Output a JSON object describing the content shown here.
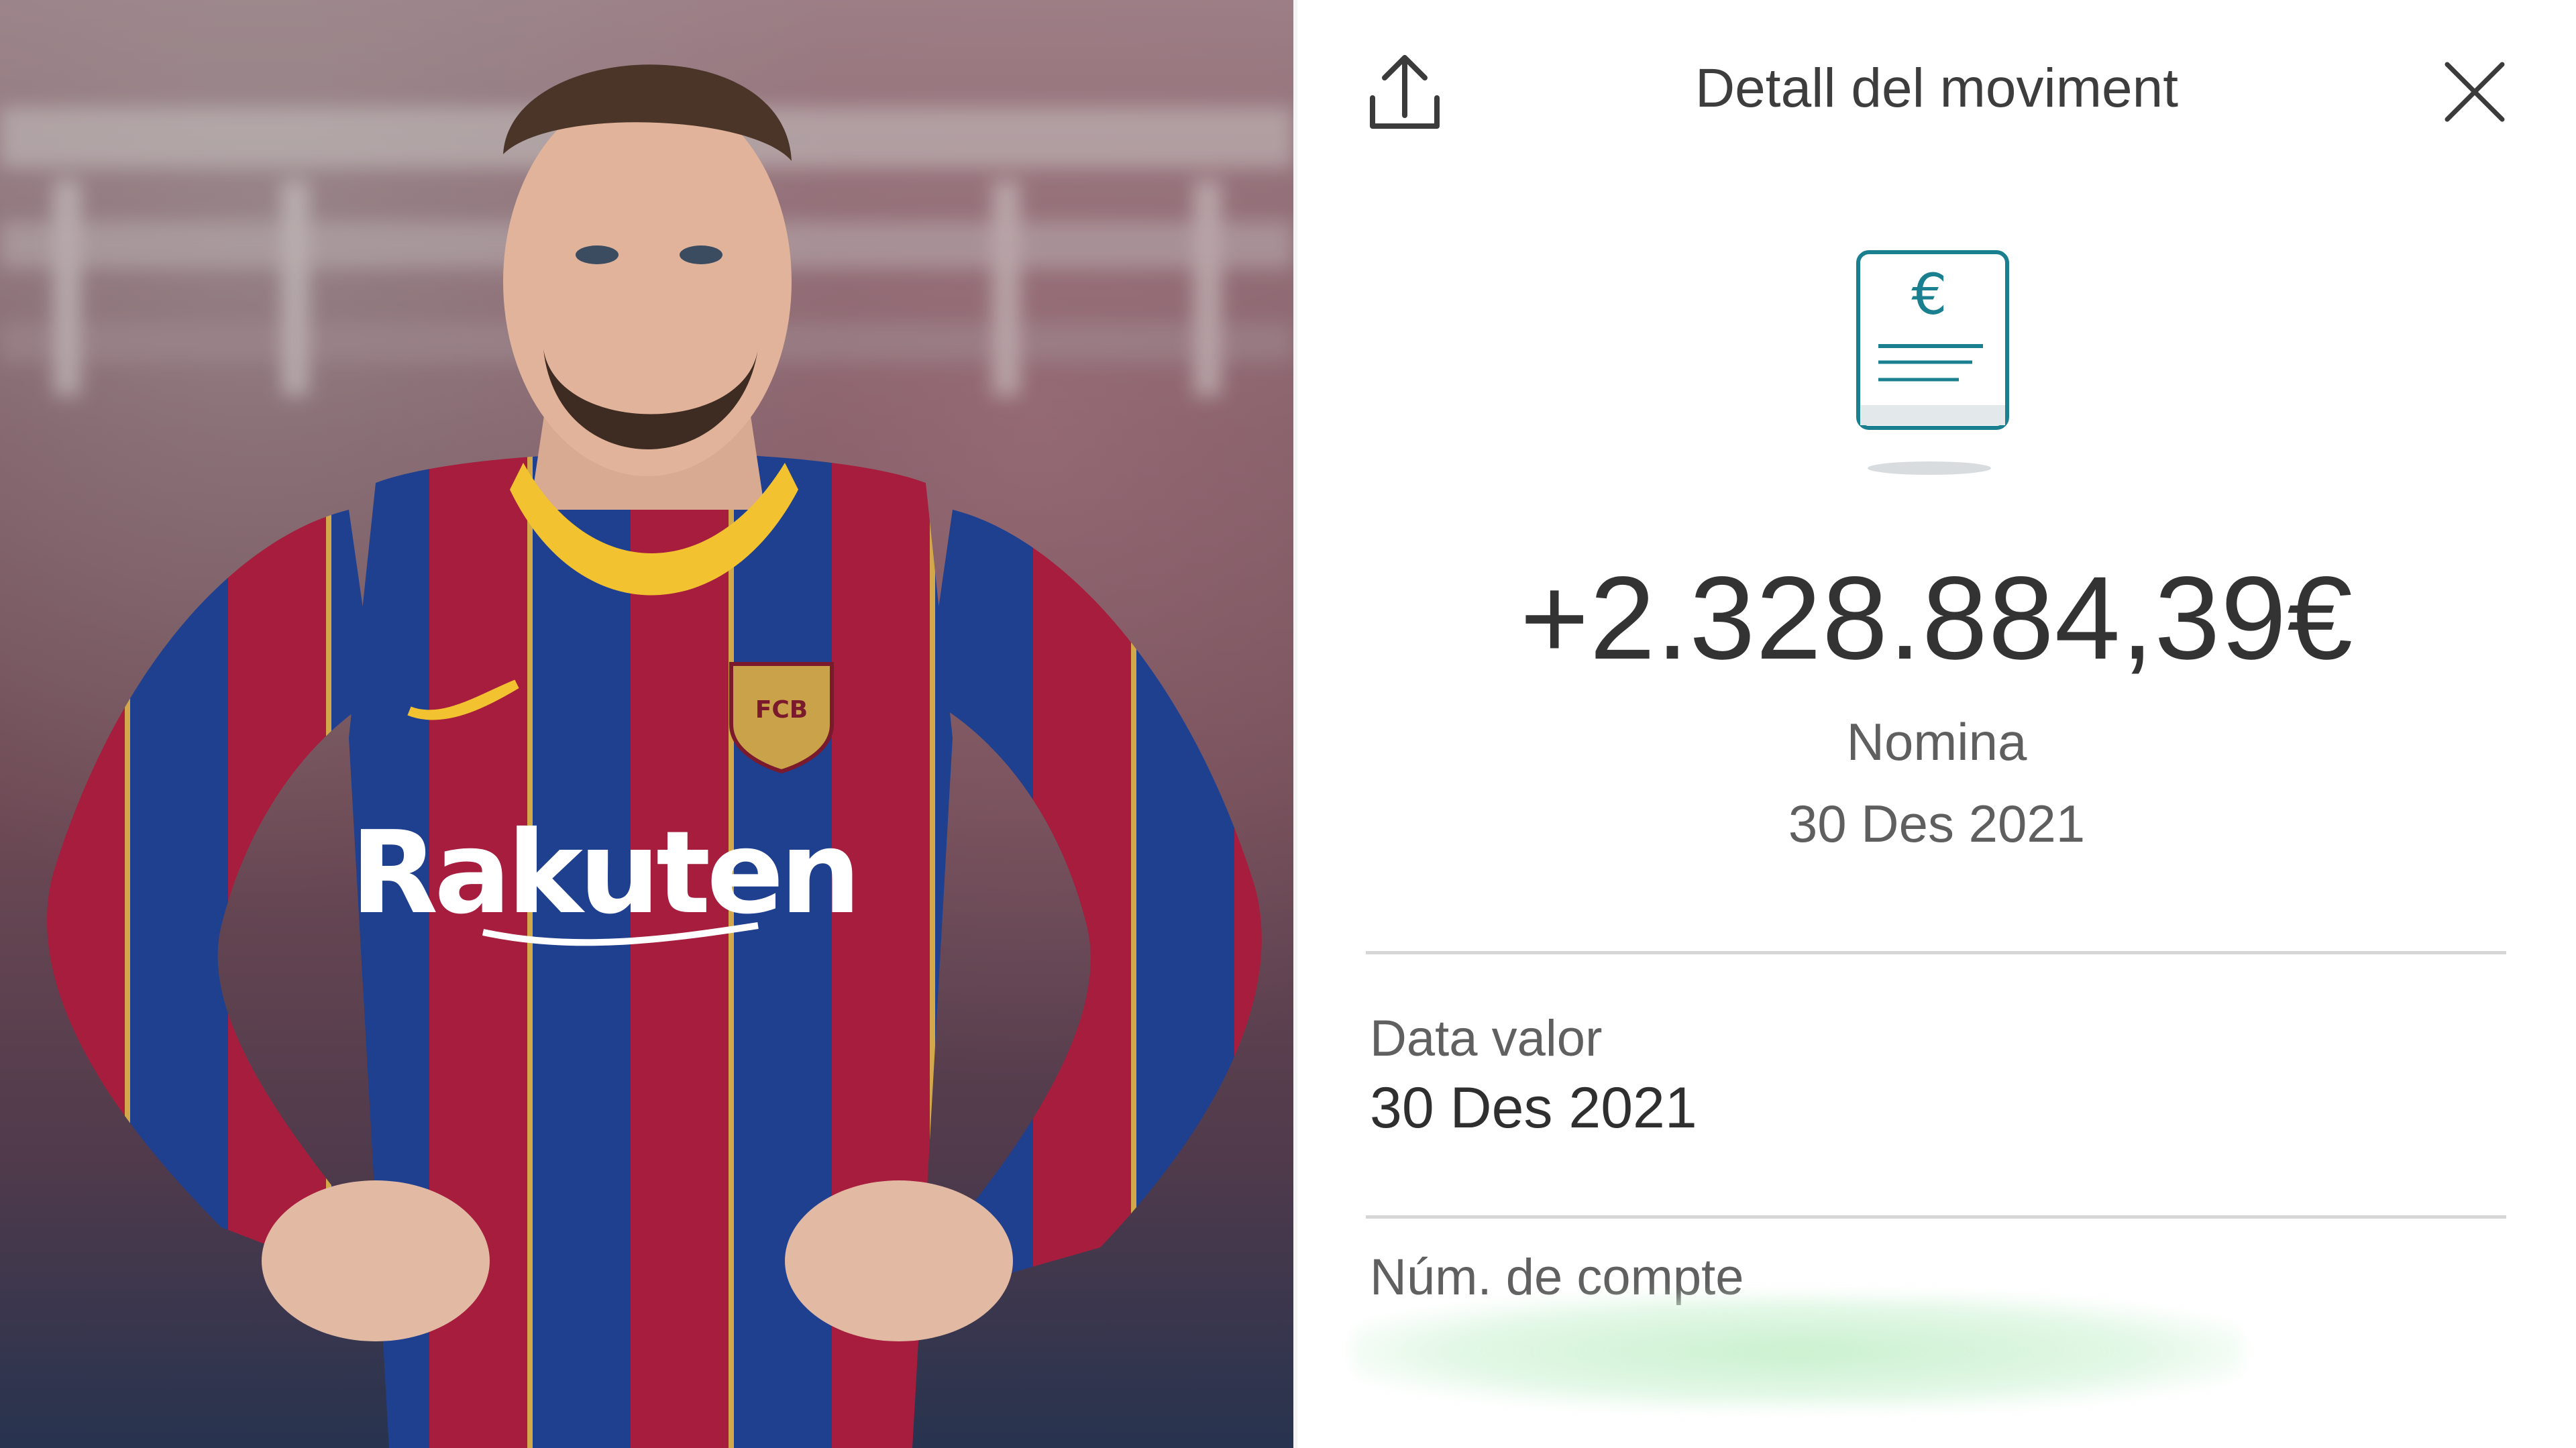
{
  "photo": {
    "jersey_sponsor": "Rakuten",
    "crest_text": "FCB",
    "colors": {
      "jersey_red": "#a61d3d",
      "jersey_blue": "#1f3f8f",
      "collar_yellow": "#f2c230"
    }
  },
  "header": {
    "title": "Detall del moviment",
    "share_icon": "share-icon",
    "close_icon": "close-icon"
  },
  "transaction": {
    "icon": "euro-document-icon",
    "currency_symbol": "€",
    "amount": "+2.328.884,39€",
    "concept": "Nomina",
    "date": "30 Des 2021"
  },
  "fields": {
    "value_date_label": "Data valor",
    "value_date": "30 Des 2021",
    "account_label": "Núm. de compte"
  },
  "colors": {
    "accent": "#1a7f8e",
    "text": "#3a3a3a",
    "divider": "#d6d6d6"
  }
}
